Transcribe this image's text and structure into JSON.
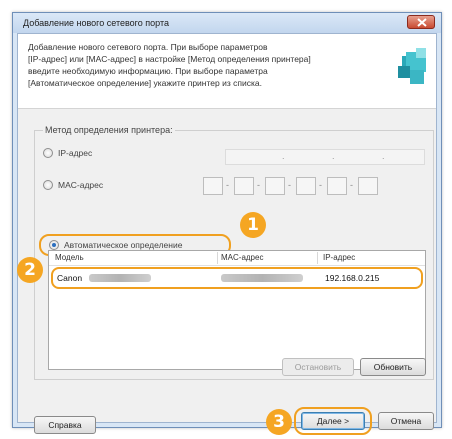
{
  "window": {
    "title": "Добавление нового сетевого порта"
  },
  "header": {
    "description": "Добавление нового сетевого порта. При выборе параметров\n[IP-адрес] или [MAC-адрес] в настройке [Метод определения принтера]\nвведите необходимую информацию. При выборе параметра\n[Автоматическое определение] укажите принтер из списка."
  },
  "method": {
    "group_label": "Метод определения принтера:",
    "ip_label": "IP-адрес",
    "mac_label": "MAC-адрес",
    "auto_label": "Автоматическое определение",
    "selected": "auto"
  },
  "table": {
    "columns": [
      "Модель",
      "MAC-адрес",
      "IP-адрес"
    ],
    "rows": [
      {
        "model": "Canon",
        "ip": "192.168.0.215"
      }
    ]
  },
  "buttons": {
    "stop": "Остановить",
    "refresh": "Обновить",
    "help": "Справка",
    "next": "Далее >",
    "cancel": "Отмена"
  },
  "callouts": [
    "1",
    "2",
    "3"
  ],
  "colors": {
    "callout": "#f5a623",
    "highlight": "#f0a020",
    "title_bar": "#c2d6ee",
    "close_button": "#c84a32"
  }
}
